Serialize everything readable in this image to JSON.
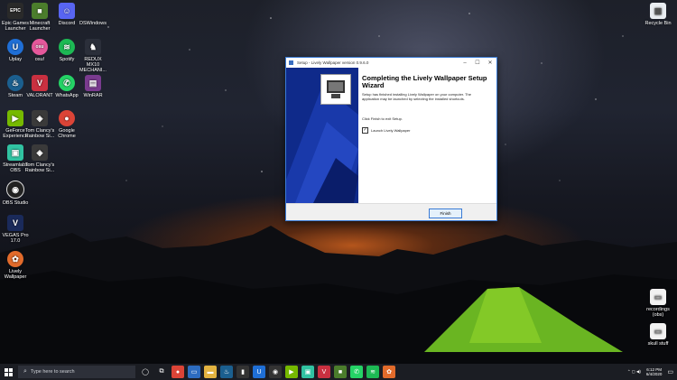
{
  "desktop_icons": [
    {
      "id": "epic",
      "label": "Epic Games Launcher",
      "glyph": "EPIC",
      "color": "#2a2a2a"
    },
    {
      "id": "minecraft",
      "label": "Minecraft Launcher",
      "glyph": "■",
      "color": "#4b7d2c"
    },
    {
      "id": "discord",
      "label": "Discord",
      "glyph": "☺",
      "color": "#5865f2"
    },
    {
      "id": "dswindows",
      "label": "DSWindows",
      "glyph": "",
      "color": "transparent"
    },
    {
      "id": "uplay",
      "label": "Uplay",
      "glyph": "U",
      "color": "#1f6fd6"
    },
    {
      "id": "osu",
      "label": "osu!",
      "glyph": "osu",
      "color": "#e5589b"
    },
    {
      "id": "spotify",
      "label": "Spotify",
      "glyph": "≋",
      "color": "#1db954"
    },
    {
      "id": "redux",
      "label": "REDUX MX10 MECHANI...",
      "glyph": "♞",
      "color": "#2b2f3a"
    },
    {
      "id": "steam",
      "label": "Steam",
      "glyph": "♨",
      "color": "#1b5f8f"
    },
    {
      "id": "valorant",
      "label": "VALORANT",
      "glyph": "V",
      "color": "#c93040"
    },
    {
      "id": "whatsapp",
      "label": "WhatsApp",
      "glyph": "✆",
      "color": "#25d366"
    },
    {
      "id": "winrar",
      "label": "WinRAR",
      "glyph": "▤",
      "color": "#7a3b8f"
    },
    {
      "id": "geforce",
      "label": "GeForce Experience",
      "glyph": "▶",
      "color": "#76b900"
    },
    {
      "id": "rainbow1",
      "label": "Tom Clancy's Rainbow Si...",
      "glyph": "◈",
      "color": "#3a3a3a"
    },
    {
      "id": "chrome",
      "label": "Google Chrome",
      "glyph": "●",
      "color": "#db4437"
    },
    {
      "id": "streamlabs",
      "label": "Streamlabs OBS",
      "glyph": "▣",
      "color": "#31c3a2"
    },
    {
      "id": "rainbow2",
      "label": "Tom Clancy's Rainbow Si...",
      "glyph": "◈",
      "color": "#3a3a3a"
    },
    {
      "id": "obs",
      "label": "OBS Studio",
      "glyph": "◉",
      "color": "#222"
    },
    {
      "id": "vegas",
      "label": "VEGAS Pro 17.0",
      "glyph": "V",
      "color": "#1a2a5a"
    },
    {
      "id": "lively",
      "label": "Lively Wallpaper",
      "glyph": "✿",
      "color": "#e26b2b"
    },
    {
      "id": "recycle",
      "label": "Recycle Bin",
      "glyph": "🗑",
      "color": "#e9edf2"
    },
    {
      "id": "recordings",
      "label": "recordings (obs)",
      "glyph": "▭",
      "color": "#f2f2f2"
    },
    {
      "id": "skullstuff",
      "label": "skull stuff",
      "glyph": "▭",
      "color": "#f2f2f2"
    }
  ],
  "setup": {
    "title": "Setup - Lively Wallpaper version 0.9.6.0",
    "heading": "Completing the Lively Wallpaper Setup Wizard",
    "para1": "Setup has finished installing Lively Wallpaper on your computer. The application may be launched by selecting the installed shortcuts.",
    "para2": "Click Finish to exit Setup.",
    "checkbox_label": "Launch Lively Wallpaper",
    "checkbox_checked": true,
    "finish_label": "Finish"
  },
  "taskbar": {
    "search_placeholder": "Type here to search",
    "time": "6:12 PM",
    "date": "6/4/2020",
    "pinned": [
      {
        "id": "task-view",
        "glyph": "◯",
        "color": "transparent"
      },
      {
        "id": "multitask",
        "glyph": "⧉",
        "color": "transparent"
      },
      {
        "id": "chrome",
        "glyph": "●",
        "color": "#db4437"
      },
      {
        "id": "mail",
        "glyph": "▭",
        "color": "#2d6cc0"
      },
      {
        "id": "explorer",
        "glyph": "▬",
        "color": "#e3b341"
      },
      {
        "id": "steam",
        "glyph": "♨",
        "color": "#1b5f8f"
      },
      {
        "id": "tb-black",
        "glyph": "▮",
        "color": "#333"
      },
      {
        "id": "uplay",
        "glyph": "U",
        "color": "#1f6fd6"
      },
      {
        "id": "obs",
        "glyph": "◉",
        "color": "#333"
      },
      {
        "id": "geforce",
        "glyph": "▶",
        "color": "#76b900"
      },
      {
        "id": "streamlabs",
        "glyph": "▣",
        "color": "#31c3a2"
      },
      {
        "id": "valorant",
        "glyph": "V",
        "color": "#c93040"
      },
      {
        "id": "minecraft",
        "glyph": "■",
        "color": "#4b7d2c"
      },
      {
        "id": "whatsapp",
        "glyph": "✆",
        "color": "#25d366"
      },
      {
        "id": "spotify",
        "glyph": "≋",
        "color": "#1db954"
      },
      {
        "id": "lively",
        "glyph": "✿",
        "color": "#e26b2b"
      }
    ],
    "tray_glyphs": "⌃ ◻ ◀)"
  }
}
